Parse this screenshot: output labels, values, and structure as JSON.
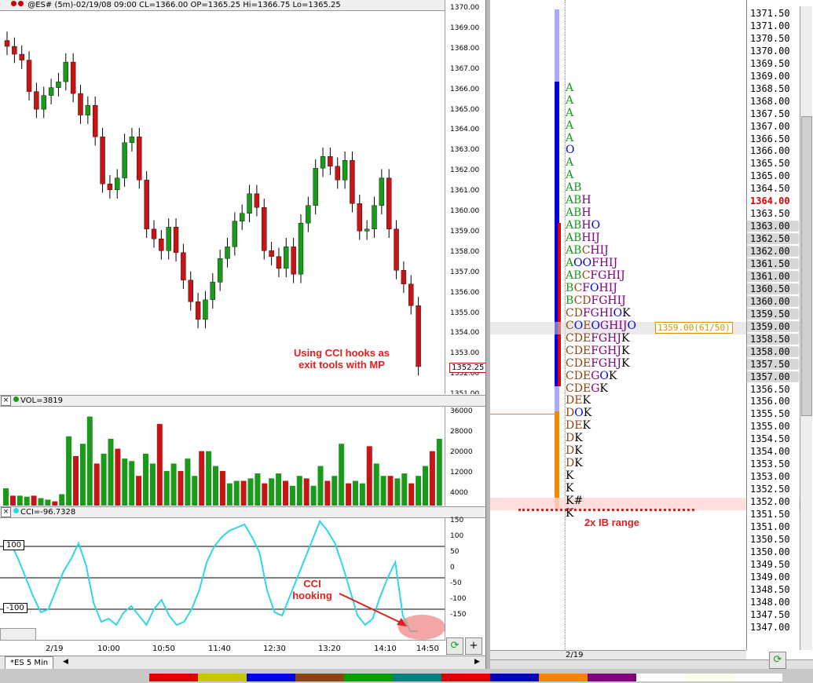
{
  "price_chart": {
    "header": "@ES# (5m)-02/19/08 09:00 CL=1366.00 OP=1365.25 Hi=1366.75 Lo=1365.25",
    "close_marker": "1352.25",
    "price_labels": [
      "1370.00",
      "1369.00",
      "1368.00",
      "1367.00",
      "1366.00",
      "1365.00",
      "1364.00",
      "1363.00",
      "1362.00",
      "1361.00",
      "1360.00",
      "1359.00",
      "1358.00",
      "1357.00",
      "1356.00",
      "1355.00",
      "1354.00",
      "1353.00",
      "1352.00",
      "1351.00"
    ],
    "annotation": [
      "Using CCI hooks as",
      "exit tools with MP"
    ]
  },
  "volume_chart": {
    "header": "VOL=3819",
    "labels": [
      "36000",
      "28000",
      "20000",
      "12000",
      "4000"
    ]
  },
  "cci_chart": {
    "header": "CCI=-96.7328",
    "labels": [
      "150",
      "100",
      "50",
      "0",
      "-50",
      "-100",
      "-150"
    ],
    "level_high": "100",
    "level_low": "-100",
    "annotation": [
      "CCI",
      "hooking"
    ]
  },
  "time_axis": [
    "2/19",
    "10:00",
    "10:50",
    "11:40",
    "12:30",
    "13:20",
    "14:10",
    "14:50"
  ],
  "tab": "*ES 5 Min",
  "market_profile": {
    "date_label": "2/19",
    "poc_label": "1359.00(61/50)",
    "ib_note": "2x IB range",
    "highlight_price": "1364.00",
    "prices": [
      "1371.50",
      "1371.00",
      "1370.50",
      "1370.00",
      "1369.50",
      "1369.00",
      "1368.50",
      "1368.00",
      "1367.50",
      "1367.00",
      "1366.50",
      "1366.00",
      "1365.50",
      "1365.00",
      "1364.50",
      "1364.00",
      "1363.50",
      "1363.00",
      "1362.50",
      "1362.00",
      "1361.50",
      "1361.00",
      "1360.50",
      "1360.00",
      "1359.50",
      "1359.00",
      "1358.50",
      "1358.00",
      "1357.50",
      "1357.00",
      "1356.50",
      "1356.00",
      "1355.50",
      "1355.00",
      "1354.50",
      "1354.00",
      "1353.50",
      "1353.00",
      "1352.50",
      "1352.00",
      "1351.50",
      "1351.00",
      "1350.50",
      "1350.00",
      "1349.50",
      "1349.00",
      "1348.50",
      "1348.00",
      "1347.50",
      "1347.00"
    ],
    "rows": [
      "",
      "",
      "",
      "",
      "",
      "",
      "A",
      "A",
      "A",
      "A",
      "A",
      "O",
      "A",
      "A",
      "AB",
      "ABH",
      "ABH",
      "ABHO",
      "ABHIJ",
      "ABCHIJ",
      "AOOFHIJ",
      "ABCFGHIJ",
      "BCFOHIJ",
      "BCDFGHIJ",
      "CDFGHIOK",
      "COEOGHIJO",
      "CDEFGHJK",
      "CDEFGHJK",
      "CDEFGHJK",
      "CDEGOK",
      "CDEGK",
      "DEK",
      "DOK",
      "DEK",
      "DK",
      "DK",
      "DK",
      "K",
      "K",
      "K#",
      "K",
      "",
      "",
      "",
      "",
      "",
      "",
      "",
      "",
      ""
    ]
  },
  "colors": {
    "up": "#1a9a1a",
    "down": "#c81414",
    "cci": "#2ed6e6",
    "annotation": "#e02020",
    "va": "#0000dd",
    "range_orange": "#f08a00",
    "range_light": "#a9a9ff"
  }
}
